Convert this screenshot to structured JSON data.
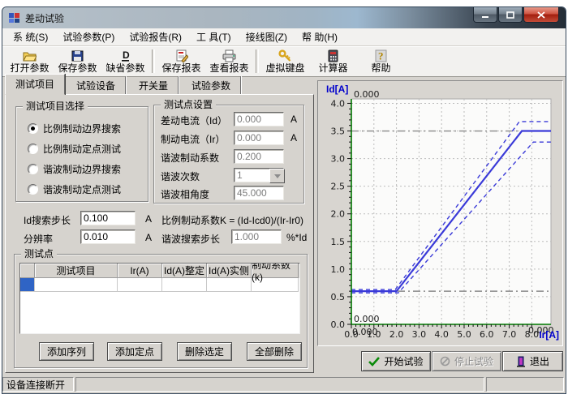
{
  "window": {
    "title": "差动试验"
  },
  "menu": {
    "items": [
      {
        "label": "系 统(S)"
      },
      {
        "label": "试验参数(P)"
      },
      {
        "label": "试验报告(R)"
      },
      {
        "label": "工 具(T)"
      },
      {
        "label": "接线图(Z)"
      },
      {
        "label": "帮 助(H)"
      }
    ]
  },
  "toolbar": {
    "buttons": [
      {
        "label": "打开参数",
        "icon": "open-folder-icon"
      },
      {
        "label": "保存参数",
        "icon": "save-icon"
      },
      {
        "label": "缺省参数",
        "icon": "default-params-icon"
      },
      {
        "label": "保存报表",
        "icon": "save-report-icon"
      },
      {
        "label": "查看报表",
        "icon": "view-report-icon"
      },
      {
        "label": "虚拟键盘",
        "icon": "virtual-keyboard-icon"
      },
      {
        "label": "计算器",
        "icon": "calculator-icon"
      },
      {
        "label": "帮助",
        "icon": "help-icon"
      }
    ]
  },
  "tabs": {
    "items": [
      {
        "label": "测试项目",
        "active": true
      },
      {
        "label": "试验设备",
        "active": false
      },
      {
        "label": "开关量",
        "active": false
      },
      {
        "label": "试验参数",
        "active": false
      }
    ]
  },
  "test_item_group": {
    "title": "测试项目选择",
    "options": [
      {
        "label": "比例制动边界搜索",
        "selected": true
      },
      {
        "label": "比例制动定点测试",
        "selected": false
      },
      {
        "label": "谐波制动边界搜索",
        "selected": false
      },
      {
        "label": "谐波制动定点测试",
        "selected": false
      }
    ]
  },
  "test_point_settings": {
    "title": "测试点设置",
    "fields": [
      {
        "label": "差动电流（Id）",
        "value": "0.000",
        "unit": "A"
      },
      {
        "label": "制动电流（Ir）",
        "value": "0.000",
        "unit": "A"
      },
      {
        "label": "谐波制动系数",
        "value": "0.200",
        "unit": ""
      },
      {
        "label": "谐波次数",
        "value": "1",
        "unit": ""
      },
      {
        "label": "谐波相角度",
        "value": "45.000",
        "unit": ""
      }
    ]
  },
  "search_settings": {
    "id_step": {
      "label": "Id搜索步长",
      "value": "0.100",
      "unit": "A"
    },
    "resolution": {
      "label": "分辨率",
      "value": "0.010",
      "unit": "A"
    },
    "formula": "比例制动系数K =  (Id-Icd0)/(Ir-Ir0)",
    "harmonic_step": {
      "label": "谐波搜索步长",
      "value": "1.000",
      "unit": "%*Id"
    }
  },
  "test_points": {
    "title": "测试点",
    "columns": [
      "",
      "测试项目",
      "Ir(A)",
      "Id(A)整定",
      "Id(A)实侧",
      "制动系数(k)"
    ],
    "buttons": [
      "添加序列",
      "添加定点",
      "删除选定",
      "全部删除"
    ]
  },
  "actions": {
    "start": "开始试验",
    "stop": "停止试验",
    "exit": "退出"
  },
  "status_bar": {
    "text": "设备连接断开"
  },
  "chart_data": {
    "type": "line",
    "title": "",
    "xlabel": "Ir[A]",
    "ylabel": "Id[A]",
    "xlim": [
      0,
      8.85
    ],
    "ylim": [
      0,
      4.08
    ],
    "xticks": [
      0,
      1,
      2,
      3,
      4,
      5,
      6,
      7,
      8
    ],
    "yticks": [
      0,
      0.5,
      1,
      1.5,
      2,
      2.5,
      3,
      3.5,
      4
    ],
    "grid": true,
    "series": [
      {
        "name": "characteristic",
        "style": "solid",
        "points": [
          [
            0,
            0.6
          ],
          [
            2.0,
            0.6
          ],
          [
            7.56,
            3.5
          ],
          [
            8.85,
            3.5
          ]
        ]
      },
      {
        "name": "upper-tolerance",
        "style": "dashed",
        "points": [
          [
            0,
            0.63
          ],
          [
            1.95,
            0.63
          ],
          [
            7.45,
            3.67
          ],
          [
            8.85,
            3.67
          ]
        ]
      },
      {
        "name": "lower-tolerance",
        "style": "dashed",
        "points": [
          [
            0,
            0.57
          ],
          [
            2.08,
            0.57
          ],
          [
            8.07,
            3.3
          ],
          [
            8.85,
            3.3
          ]
        ]
      }
    ],
    "reference_lines_y": [
      3.5,
      0.6
    ],
    "corner_labels": {
      "top_left": "0.000",
      "bottom_left_upper": "0.000",
      "bottom_left_lower": "0.000",
      "bottom_right": "0.000"
    },
    "colors": {
      "line": "#3a3ad8",
      "axis": "#007a00",
      "grid": "#bdbdbd",
      "reference": "#8a8a8a",
      "axis_title": "#0000cc"
    }
  }
}
